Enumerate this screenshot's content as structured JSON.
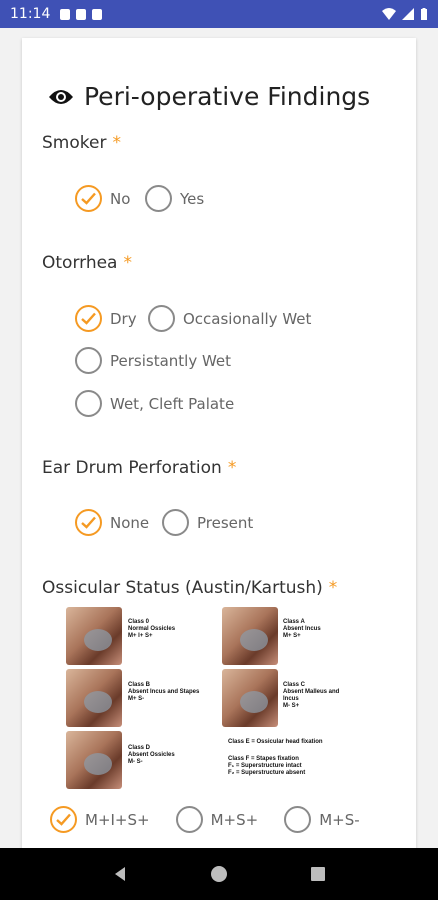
{
  "status_bar": {
    "time": "11:14"
  },
  "header": {
    "title": "Peri-operative Findings",
    "icon": "eye-icon"
  },
  "colors": {
    "accent": "#f59a23",
    "status_bar": "#3f51b5"
  },
  "questions": {
    "smoker": {
      "label": "Smoker",
      "required": "*",
      "options": [
        "No",
        "Yes"
      ],
      "selected": "No"
    },
    "otorrhea": {
      "label": "Otorrhea",
      "required": "*",
      "options": [
        "Dry",
        "Occasionally Wet",
        "Persistantly Wet",
        "Wet, Cleft Palate"
      ],
      "selected": "Dry"
    },
    "perforation": {
      "label": "Ear Drum Perforation",
      "required": "*",
      "options": [
        "None",
        "Present"
      ],
      "selected": "None"
    },
    "ossicular": {
      "label": "Ossicular Status (Austin/Kartush)",
      "required": "*",
      "classes": {
        "o": "Class 0\nNormal Ossicles\nM+ I+ S+",
        "a": "Class A\nAbsent Incus\nM+ S+",
        "b": "Class B\nAbsent Incus and Stapes\nM+ S-",
        "c": "Class C\nAbsent Malleus and Incus\nM- S+",
        "d": "Class D\nAbsent Ossicles\nM- S-",
        "e": "Class E = Ossicular head fixation",
        "f": "Class F = Stapes fixation\nF₁ = Superstructure intact\nF₂ = Superstructure absent"
      },
      "options": [
        "M+I+S+",
        "M+S+",
        "M+S-"
      ]
    }
  }
}
